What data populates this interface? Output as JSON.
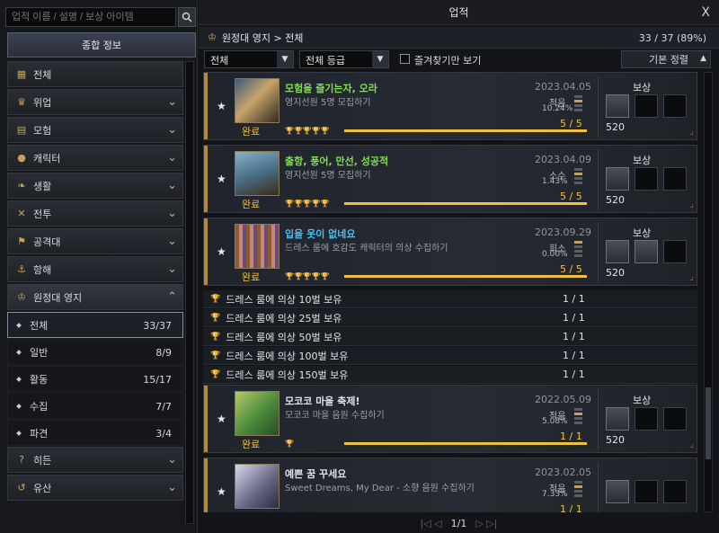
{
  "search": {
    "placeholder": "업적 이름 / 설명 / 보상 아이템"
  },
  "sidebar": {
    "summary_label": "종합 정보",
    "categories": [
      {
        "label": "전체"
      },
      {
        "label": "위업"
      },
      {
        "label": "모험"
      },
      {
        "label": "캐릭터"
      },
      {
        "label": "생활"
      },
      {
        "label": "전투"
      },
      {
        "label": "공격대"
      },
      {
        "label": "항해"
      },
      {
        "label": "원정대 영지"
      }
    ],
    "subcategories": [
      {
        "label": "전체",
        "count": "33/37"
      },
      {
        "label": "일반",
        "count": "8/9"
      },
      {
        "label": "활동",
        "count": "15/17"
      },
      {
        "label": "수집",
        "count": "7/7"
      },
      {
        "label": "파견",
        "count": "3/4"
      }
    ],
    "after": [
      {
        "label": "히든"
      },
      {
        "label": "유산"
      }
    ]
  },
  "main": {
    "title": "업적",
    "close": "X",
    "breadcrumb": "원정대 영지 > 전체",
    "progress": "33 / 37 (89%)",
    "filter1": "전체",
    "filter2": "전체 등급",
    "fav_label": "즐겨찾기만 보기",
    "sort_label": "기본 정렬",
    "page": "1/1"
  },
  "achievements": [
    {
      "name": "모험을 즐기는자, 오라",
      "desc": "영지선원 5명 모집하기",
      "date": "2023.04.05",
      "rarity": "적음",
      "pct": "10.24%",
      "count": "5 / 5",
      "done": "완료",
      "reward_label": "보상",
      "reward_num": "520",
      "name_color": "#7fe04a",
      "progress": 1.0
    },
    {
      "name": "출항, 풍어, 만선, 성공적",
      "desc": "영지선원 5명 모집하기",
      "date": "2023.04.09",
      "rarity": "소수",
      "pct": "1.43%",
      "count": "5 / 5",
      "done": "완료",
      "reward_label": "보상",
      "reward_num": "520",
      "name_color": "#7fe04a",
      "progress": 1.0
    },
    {
      "name": "입을 옷이 없네요",
      "desc": "드레스 룸에 호감도 캐릭터의 의상 수집하기",
      "date": "2023.09.29",
      "rarity": "희소",
      "pct": "0.00%",
      "count": "5 / 5",
      "done": "완료",
      "reward_label": "보상",
      "reward_num": "520",
      "name_color": "#4ac0f0",
      "progress": 1.0
    },
    {
      "name": "모코코 마을 축제!",
      "desc": "모코코 마을 음원 수집하기",
      "date": "2022.05.09",
      "rarity": "적음",
      "pct": "5.08%",
      "count": "1 / 1",
      "done": "완료",
      "reward_label": "보상",
      "reward_num": "520",
      "name_color": "#e0e3e6",
      "progress": 1.0
    },
    {
      "name": "예쁜 꿈 꾸세요",
      "desc": "Sweet Dreams, My Dear - 소향 음원 수집하기",
      "date": "2023.02.05",
      "rarity": "적음",
      "pct": "7.33%",
      "count": "1 / 1",
      "done": "",
      "reward_label": "",
      "reward_num": "",
      "name_color": "#e0e3e6",
      "progress": 1.0
    }
  ],
  "subrows": [
    {
      "label": "드레스 룸에 의상 10벌 보유",
      "score": "1 / 1"
    },
    {
      "label": "드레스 룸에 의상 25벌 보유",
      "score": "1 / 1"
    },
    {
      "label": "드레스 룸에 의상 50벌 보유",
      "score": "1 / 1"
    },
    {
      "label": "드레스 룸에 의상 100벌 보유",
      "score": "1 / 1"
    },
    {
      "label": "드레스 룸에 의상 150벌 보유",
      "score": "1 / 1"
    }
  ],
  "colors": {
    "gold": "#f0c040",
    "accent": "#c6a35a",
    "panel": "#20242c"
  },
  "icons": [
    "search-icon",
    "grid-icon",
    "trophy-icon",
    "book-icon",
    "person-icon",
    "leaf-icon",
    "swords-icon",
    "flag-icon",
    "ship-icon",
    "crown-icon",
    "question-icon",
    "history-icon",
    "chevron-down-icon",
    "star-icon",
    "close-icon"
  ]
}
